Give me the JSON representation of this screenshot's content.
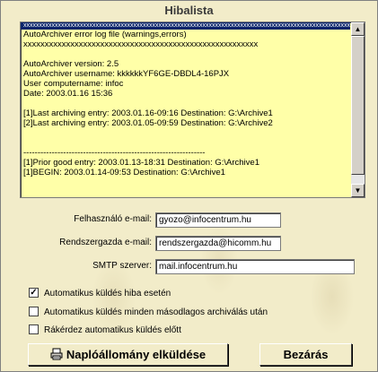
{
  "window": {
    "title": "Hibalista"
  },
  "log": {
    "lines": [
      {
        "text": "xxxxxxxxxxxxxxxxxxxxxxxxxxxxxxxxxxxxxxxxxxxxxxxxxxxxxxxxxxxxxxxxxxxxxxxxxxxxxxxxxxxxxxxxxxxxxxxxxxxxxxxx",
        "selected": true
      },
      {
        "text": "AutoArchiver error log file (warnings,errors)"
      },
      {
        "text": "xxxxxxxxxxxxxxxxxxxxxxxxxxxxxxxxxxxxxxxxxxxxxxxxxxxxxxx"
      },
      {
        "text": ""
      },
      {
        "text": "AutoArchiver version: 2.5"
      },
      {
        "text": "AutoArchiver username: kkkkkkYF6GE-DBDL4-16PJX"
      },
      {
        "text": "User computername: infoc"
      },
      {
        "text": "Date: 2003.01.16 15:36"
      },
      {
        "text": ""
      },
      {
        "text": "[1]Last archiving entry: 2003.01.16-09:16 Destination: G:\\Archive1"
      },
      {
        "text": "[2]Last archiving entry: 2003.01.05-09:59 Destination: G:\\Archive2"
      },
      {
        "text": ""
      },
      {
        "text": ""
      },
      {
        "text": "----------------------------------------------------------------"
      },
      {
        "text": "[1]Prior good entry: 2003.01.13-18:31 Destination: G:\\Archive1"
      },
      {
        "text": "[1]BEGIN: 2003.01.14-09:53 Destination: G:\\Archive1"
      }
    ]
  },
  "form": {
    "user_email_label": "Felhasználó e-mail:",
    "user_email_value": "gyozo@infocentrum.hu",
    "admin_email_label": "Rendszergazda e-mail:",
    "admin_email_value": "rendszergazda@hicomm.hu",
    "smtp_label": "SMTP szerver:",
    "smtp_value": "mail.infocentrum.hu"
  },
  "options": [
    {
      "label": "Automatikus küldés hiba esetén",
      "checked": true
    },
    {
      "label": "Automatikus küldés minden másodlagos archiválás után",
      "checked": false
    },
    {
      "label": "Rákérdez automatikus küldés előtt",
      "checked": false
    }
  ],
  "buttons": {
    "send_label": "Naplóállomány elküldése",
    "close_label": "Bezárás"
  },
  "icons": {
    "send": "printer-icon",
    "scroll_up": "arrow-up-icon",
    "scroll_down": "arrow-down-icon",
    "check": "checkmark-icon"
  }
}
